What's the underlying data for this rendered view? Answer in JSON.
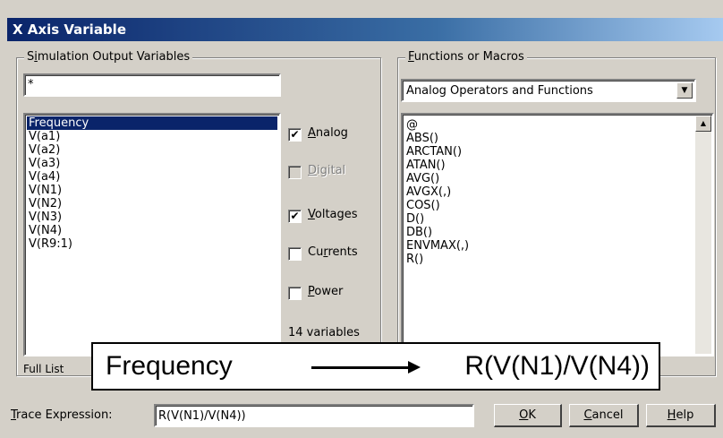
{
  "window": {
    "title": "X Axis Variable"
  },
  "sim_group": {
    "legend_pre": "S",
    "legend_ul": "i",
    "legend_post": "mulation Output Variables",
    "filter_value": "*",
    "variables": [
      "Frequency",
      "V(a1)",
      "V(a2)",
      "V(a3)",
      "V(a4)",
      "V(N1)",
      "V(N2)",
      "V(N3)",
      "V(N4)",
      "V(R9:1)"
    ],
    "selected_index": 0,
    "checks": {
      "analog": {
        "ul": "A",
        "rest": "nalog",
        "checked": true
      },
      "digital": {
        "ul": "D",
        "rest": "igital",
        "checked": false,
        "disabled": true
      },
      "voltages": {
        "ul": "V",
        "rest": "oltages",
        "checked": true
      },
      "currents": {
        "pre": "Cu",
        "ul": "r",
        "rest": "rents",
        "checked": false
      },
      "power": {
        "ul": "P",
        "rest": "ower",
        "checked": false
      }
    },
    "count_text": "14 variables",
    "full_list_label": "Full List"
  },
  "func_group": {
    "legend_ul": "F",
    "legend_rest": "unctions or Macros",
    "dropdown_value": "Analog Operators and Functions",
    "functions": [
      "@",
      "ABS()",
      "ARCTAN()",
      "ATAN()",
      "AVG()",
      "AVGX(,)",
      "COS()",
      "D()",
      "DB()",
      "ENVMAX(,)",
      "R()"
    ]
  },
  "trace": {
    "label_ul": "T",
    "label_rest": "race Expression:",
    "value": "R(V(N1)/V(N4))"
  },
  "buttons": {
    "ok": {
      "ul": "O",
      "rest": "K"
    },
    "cancel": {
      "ul": "C",
      "rest": "ancel"
    },
    "help": {
      "ul": "H",
      "rest": "elp"
    }
  },
  "annotation": {
    "from": "Frequency",
    "to": "R(V(N1)/V(N4))"
  }
}
